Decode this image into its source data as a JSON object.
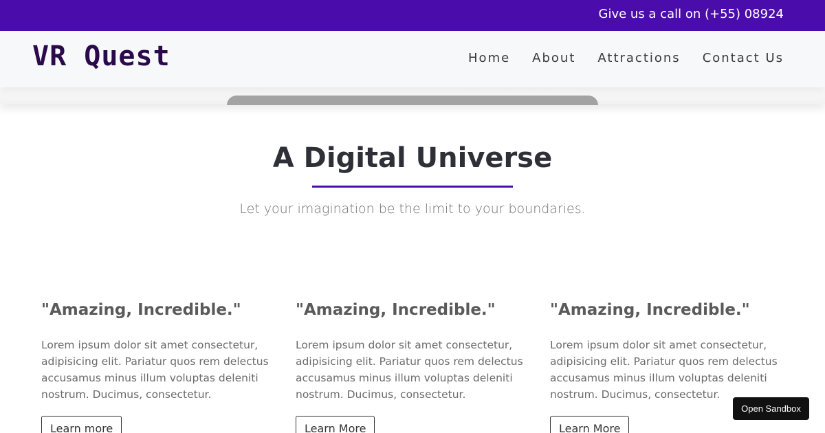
{
  "topbar": {
    "text": "Give us a call on (+55) 08924"
  },
  "brand": {
    "name": "VR Quest"
  },
  "nav": {
    "items": [
      "Home",
      "About",
      "Attractions",
      "Contact Us"
    ]
  },
  "hero": {
    "title": "A Digital Universe",
    "subtitle": "Let your imagination be the limit to your boundaries."
  },
  "cards": [
    {
      "quote": "\"Amazing, Incredible.\"",
      "body": "Lorem ipsum dolor sit amet consectetur, adipisicing elit. Pariatur quos rem delectus accusamus minus illum voluptas deleniti nostrum. Ducimus, consectetur.",
      "button": "Learn more"
    },
    {
      "quote": "\"Amazing, Incredible.\"",
      "body": "Lorem ipsum dolor sit amet consectetur, adipisicing elit. Pariatur quos rem delectus accusamus minus illum voluptas deleniti nostrum. Ducimus, consectetur.",
      "button": "Learn More"
    },
    {
      "quote": "\"Amazing, Incredible.\"",
      "body": "Lorem ipsum dolor sit amet consectetur, adipisicing elit. Pariatur quos rem delectus accusamus minus illum voluptas deleniti nostrum. Ducimus, consectetur.",
      "button": "Learn More"
    }
  ],
  "sandbox": {
    "label": "Open Sandbox"
  },
  "colors": {
    "accent": "#4a0dab",
    "brand_text": "#2a0a4a"
  }
}
